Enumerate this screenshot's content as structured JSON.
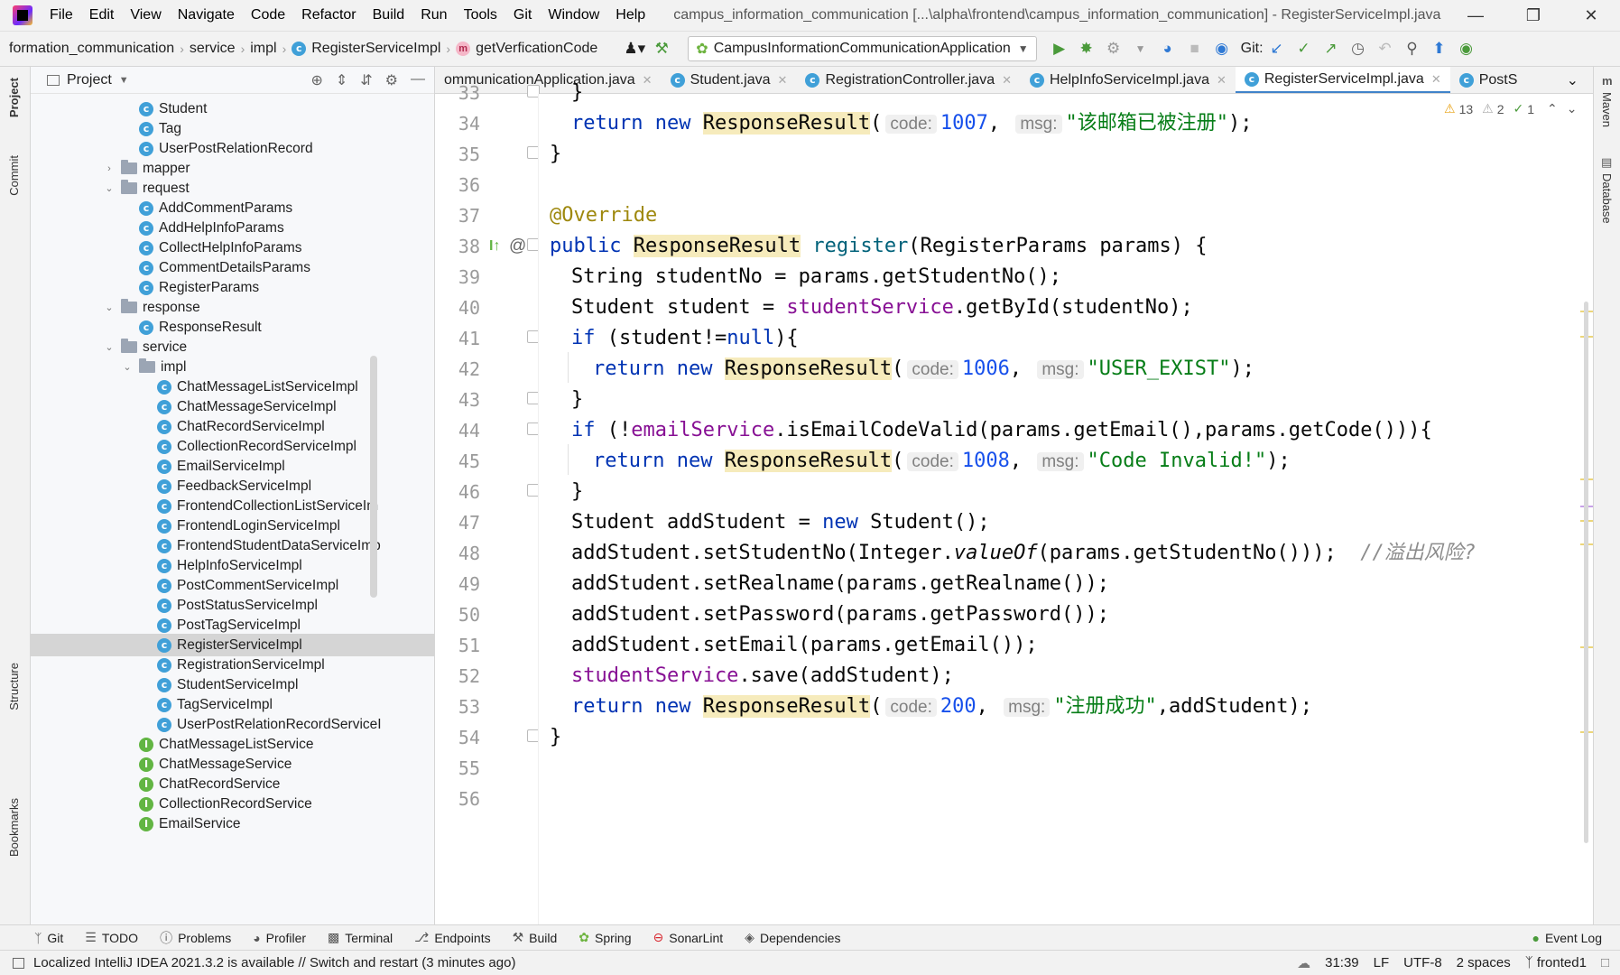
{
  "menubar": {
    "items": [
      "File",
      "Edit",
      "View",
      "Navigate",
      "Code",
      "Refactor",
      "Build",
      "Run",
      "Tools",
      "Git",
      "Window",
      "Help"
    ],
    "title": "campus_information_communication [...\\alpha\\frontend\\campus_information_communication] - RegisterServiceImpl.java"
  },
  "navbar": {
    "breadcrumbs": [
      "formation_communication",
      "service",
      "impl",
      "RegisterServiceImpl",
      "getVerficationCode"
    ],
    "run_config": "CampusInformationCommunicationApplication",
    "git_label": "Git:"
  },
  "project": {
    "title": "Project",
    "rows": [
      {
        "label": "Student",
        "type": "class",
        "indent": 2
      },
      {
        "label": "Tag",
        "type": "class",
        "indent": 2
      },
      {
        "label": "UserPostRelationRecord",
        "type": "class",
        "indent": 2
      },
      {
        "label": "mapper",
        "type": "folder",
        "indent": 1,
        "expanded": false
      },
      {
        "label": "request",
        "type": "folder",
        "indent": 1,
        "expanded": true
      },
      {
        "label": "AddCommentParams",
        "type": "class",
        "indent": 2
      },
      {
        "label": "AddHelpInfoParams",
        "type": "class",
        "indent": 2
      },
      {
        "label": "CollectHelpInfoParams",
        "type": "class",
        "indent": 2
      },
      {
        "label": "CommentDetailsParams",
        "type": "class",
        "indent": 2
      },
      {
        "label": "RegisterParams",
        "type": "class",
        "indent": 2
      },
      {
        "label": "response",
        "type": "folder",
        "indent": 1,
        "expanded": true
      },
      {
        "label": "ResponseResult",
        "type": "class",
        "indent": 2
      },
      {
        "label": "service",
        "type": "folder",
        "indent": 1,
        "expanded": true
      },
      {
        "label": "impl",
        "type": "folder",
        "indent": 2,
        "expanded": true
      },
      {
        "label": "ChatMessageListServiceImpl",
        "type": "class",
        "indent": 3
      },
      {
        "label": "ChatMessageServiceImpl",
        "type": "class",
        "indent": 3
      },
      {
        "label": "ChatRecordServiceImpl",
        "type": "class",
        "indent": 3
      },
      {
        "label": "CollectionRecordServiceImpl",
        "type": "class",
        "indent": 3
      },
      {
        "label": "EmailServiceImpl",
        "type": "class",
        "indent": 3
      },
      {
        "label": "FeedbackServiceImpl",
        "type": "class",
        "indent": 3
      },
      {
        "label": "FrontendCollectionListServiceIm",
        "type": "class",
        "indent": 3
      },
      {
        "label": "FrontendLoginServiceImpl",
        "type": "class",
        "indent": 3
      },
      {
        "label": "FrontendStudentDataServiceImp",
        "type": "class",
        "indent": 3
      },
      {
        "label": "HelpInfoServiceImpl",
        "type": "class",
        "indent": 3
      },
      {
        "label": "PostCommentServiceImpl",
        "type": "class",
        "indent": 3
      },
      {
        "label": "PostStatusServiceImpl",
        "type": "class",
        "indent": 3
      },
      {
        "label": "PostTagServiceImpl",
        "type": "class",
        "indent": 3
      },
      {
        "label": "RegisterServiceImpl",
        "type": "class",
        "indent": 3,
        "selected": true
      },
      {
        "label": "RegistrationServiceImpl",
        "type": "class",
        "indent": 3
      },
      {
        "label": "StudentServiceImpl",
        "type": "class",
        "indent": 3
      },
      {
        "label": "TagServiceImpl",
        "type": "class",
        "indent": 3
      },
      {
        "label": "UserPostRelationRecordServiceI",
        "type": "class",
        "indent": 3
      },
      {
        "label": "ChatMessageListService",
        "type": "interface",
        "indent": 2
      },
      {
        "label": "ChatMessageService",
        "type": "interface",
        "indent": 2
      },
      {
        "label": "ChatRecordService",
        "type": "interface",
        "indent": 2
      },
      {
        "label": "CollectionRecordService",
        "type": "interface",
        "indent": 2
      },
      {
        "label": "EmailService",
        "type": "interface",
        "indent": 2
      }
    ]
  },
  "tabs": [
    {
      "label": "ommunicationApplication.java",
      "active": false
    },
    {
      "label": "Student.java",
      "active": false
    },
    {
      "label": "RegistrationController.java",
      "active": false
    },
    {
      "label": "HelpInfoServiceImpl.java",
      "active": false
    },
    {
      "label": "RegisterServiceImpl.java",
      "active": true
    },
    {
      "label": "PostS",
      "active": false
    }
  ],
  "inspections": {
    "warnings": "13",
    "weak_warnings": "2",
    "ok": "1"
  },
  "editor": {
    "line_numbers": [
      "33",
      "34",
      "35",
      "36",
      "37",
      "38",
      "39",
      "40",
      "41",
      "42",
      "43",
      "44",
      "45",
      "46",
      "47",
      "48",
      "49",
      "50",
      "51",
      "52",
      "53",
      "54",
      "55",
      "56"
    ],
    "lines": {
      "l33": "}",
      "l34_kw": "return new",
      "l34_cls": "ResponseResult",
      "l34_h1": "code:",
      "l34_v1": "1007",
      "l34_h2": "msg:",
      "l34_str": "\"该邮箱已被注册\"",
      "l35": "}",
      "l37": "@Override",
      "l38_kw": "public",
      "l38_cls": "ResponseResult",
      "l38_fn": "register",
      "l38_rest": "(RegisterParams params) {",
      "l39": "String studentNo = params.getStudentNo();",
      "l40_a": "Student student = ",
      "l40_f": "studentService",
      "l40_b": ".getById(studentNo);",
      "l41_kw": "if",
      "l41_a": " (student!=",
      "l41_null": "null",
      "l41_b": "){",
      "l42_kw": "return new",
      "l42_cls": "ResponseResult",
      "l42_h1": "code:",
      "l42_v1": "1006",
      "l42_h2": "msg:",
      "l42_str": "\"USER_EXIST\"",
      "l43": "}",
      "l44_kw": "if",
      "l44_a": " (!",
      "l44_f": "emailService",
      "l44_b": ".isEmailCodeValid(params.getEmail(),params.getCode())){",
      "l45_kw": "return new",
      "l45_cls": "ResponseResult",
      "l45_h1": "code:",
      "l45_v1": "1008",
      "l45_h2": "msg:",
      "l45_str": "\"Code Invalid!\"",
      "l46": "}",
      "l47_a": "Student addStudent = ",
      "l47_kw": "new",
      "l47_b": " Student();",
      "l48_a": "addStudent.setStudentNo(Integer.",
      "l48_it": "valueOf",
      "l48_b": "(params.getStudentNo()));",
      "l48_cmt": "//溢出风险?",
      "l49": "addStudent.setRealname(params.getRealname());",
      "l50": "addStudent.setPassword(params.getPassword());",
      "l51": "addStudent.setEmail(params.getEmail());",
      "l52_f": "studentService",
      "l52_b": ".save(addStudent);",
      "l53_kw": "return new",
      "l53_cls": "ResponseResult",
      "l53_h1": "code:",
      "l53_v1": "200",
      "l53_h2": "msg:",
      "l53_str": "\"注册成功\"",
      "l53_b": ",addStudent);",
      "l54": "}"
    }
  },
  "right_strip": {
    "maven": "Maven",
    "database": "Database"
  },
  "left_strip": {
    "project": "Project",
    "commit": "Commit",
    "structure": "Structure",
    "bookmarks": "Bookmarks"
  },
  "bottom_tools": [
    "Git",
    "TODO",
    "Problems",
    "Profiler",
    "Terminal",
    "Endpoints",
    "Build",
    "Spring",
    "SonarLint",
    "Dependencies"
  ],
  "event_log": "Event Log",
  "status": {
    "message": "Localized IntelliJ IDEA 2021.3.2 is available // Switch and restart (3 minutes ago)",
    "position": "31:39",
    "line_sep": "LF",
    "encoding": "UTF-8",
    "indent": "2 spaces",
    "branch": "fronted1"
  }
}
